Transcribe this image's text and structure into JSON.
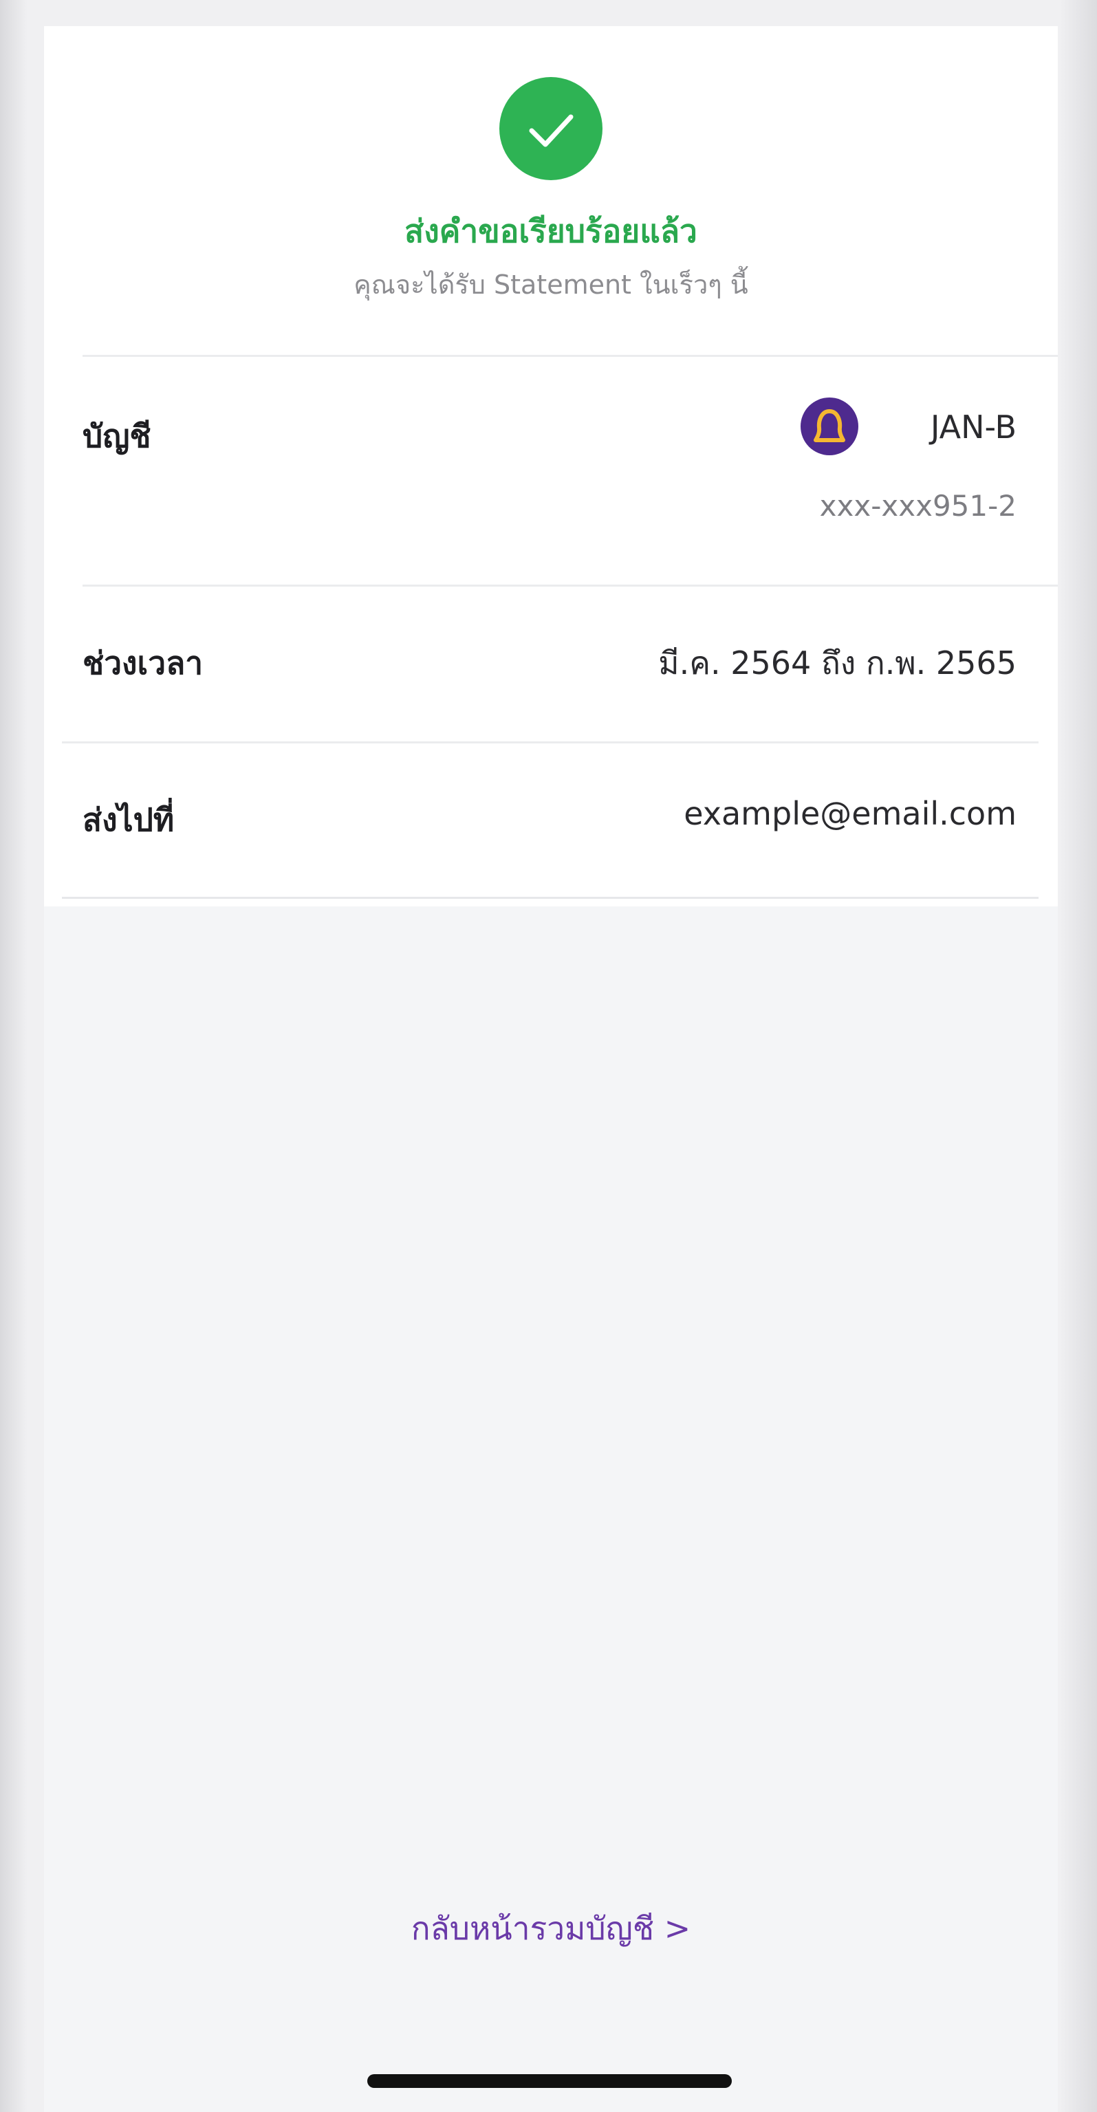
{
  "status": {
    "title": "ส่งคำขอเรียบร้อยแล้ว",
    "subtitle": "คุณจะได้รับ Statement ในเร็วๆ นี้",
    "icon": "check-icon",
    "accent_color": "#2eb354"
  },
  "details": {
    "account": {
      "label": "บัญชี",
      "bank_icon": "bank-logo-icon",
      "name": "JAN-B",
      "number": "xxx-xxx951-2"
    },
    "period": {
      "label": "ช่วงเวลา",
      "value": "มี.ค. 2564 ถึง ก.พ. 2565"
    },
    "send_to": {
      "label": "ส่งไปที่",
      "value": "example@email.com"
    }
  },
  "footer": {
    "back_link": "กลับหน้ารวมบัญชี >",
    "link_color": "#6a3aa8"
  }
}
